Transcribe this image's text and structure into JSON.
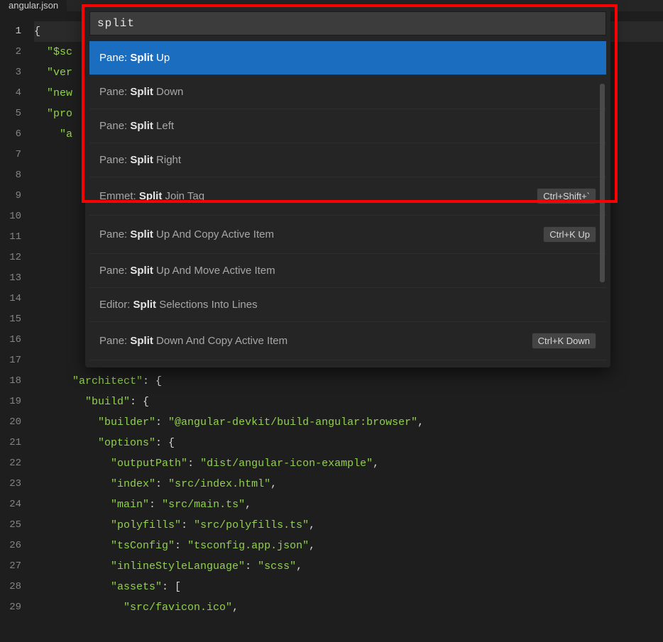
{
  "tab": {
    "title": "angular.json"
  },
  "gutter": [
    "1",
    "2",
    "3",
    "4",
    "5",
    "6",
    "7",
    "8",
    "9",
    "10",
    "11",
    "12",
    "13",
    "14",
    "15",
    "16",
    "17",
    "18",
    "19",
    "20",
    "21",
    "22",
    "23",
    "24",
    "25",
    "26",
    "27",
    "28",
    "29"
  ],
  "current_line": 1,
  "code_lines": [
    {
      "indent": 0,
      "tokens": [
        {
          "cls": "p",
          "t": "{"
        }
      ]
    },
    {
      "indent": 1,
      "tokens": [
        {
          "cls": "k",
          "t": "\"$sc"
        }
      ]
    },
    {
      "indent": 1,
      "tokens": [
        {
          "cls": "k",
          "t": "\"ver"
        }
      ]
    },
    {
      "indent": 1,
      "tokens": [
        {
          "cls": "k",
          "t": "\"new"
        }
      ]
    },
    {
      "indent": 1,
      "tokens": [
        {
          "cls": "k",
          "t": "\"pro"
        }
      ]
    },
    {
      "indent": 2,
      "tokens": [
        {
          "cls": "k",
          "t": "\"a"
        }
      ]
    },
    {
      "indent": 0,
      "tokens": []
    },
    {
      "indent": 0,
      "tokens": []
    },
    {
      "indent": 0,
      "tokens": []
    },
    {
      "indent": 0,
      "tokens": []
    },
    {
      "indent": 0,
      "tokens": []
    },
    {
      "indent": 0,
      "tokens": []
    },
    {
      "indent": 0,
      "tokens": []
    },
    {
      "indent": 0,
      "tokens": []
    },
    {
      "indent": 0,
      "tokens": []
    },
    {
      "indent": 0,
      "tokens": []
    },
    {
      "indent": 0,
      "tokens": []
    },
    {
      "indent": 3,
      "tokens": [
        {
          "cls": "k",
          "t": "\"architect\""
        },
        {
          "cls": "p",
          "t": ": {"
        }
      ]
    },
    {
      "indent": 4,
      "tokens": [
        {
          "cls": "k",
          "t": "\"build\""
        },
        {
          "cls": "p",
          "t": ": {"
        }
      ]
    },
    {
      "indent": 5,
      "tokens": [
        {
          "cls": "k",
          "t": "\"builder\""
        },
        {
          "cls": "p",
          "t": ": "
        },
        {
          "cls": "v",
          "t": "\"@angular-devkit/build-angular:browser\""
        },
        {
          "cls": "p",
          "t": ","
        }
      ]
    },
    {
      "indent": 5,
      "tokens": [
        {
          "cls": "k",
          "t": "\"options\""
        },
        {
          "cls": "p",
          "t": ": {"
        }
      ]
    },
    {
      "indent": 6,
      "tokens": [
        {
          "cls": "k",
          "t": "\"outputPath\""
        },
        {
          "cls": "p",
          "t": ": "
        },
        {
          "cls": "v",
          "t": "\"dist/angular-icon-example\""
        },
        {
          "cls": "p",
          "t": ","
        }
      ]
    },
    {
      "indent": 6,
      "tokens": [
        {
          "cls": "k",
          "t": "\"index\""
        },
        {
          "cls": "p",
          "t": ": "
        },
        {
          "cls": "v",
          "t": "\"src/index.html\""
        },
        {
          "cls": "p",
          "t": ","
        }
      ]
    },
    {
      "indent": 6,
      "tokens": [
        {
          "cls": "k",
          "t": "\"main\""
        },
        {
          "cls": "p",
          "t": ": "
        },
        {
          "cls": "v",
          "t": "\"src/main.ts\""
        },
        {
          "cls": "p",
          "t": ","
        }
      ]
    },
    {
      "indent": 6,
      "tokens": [
        {
          "cls": "k",
          "t": "\"polyfills\""
        },
        {
          "cls": "p",
          "t": ": "
        },
        {
          "cls": "v",
          "t": "\"src/polyfills.ts\""
        },
        {
          "cls": "p",
          "t": ","
        }
      ]
    },
    {
      "indent": 6,
      "tokens": [
        {
          "cls": "k",
          "t": "\"tsConfig\""
        },
        {
          "cls": "p",
          "t": ": "
        },
        {
          "cls": "v",
          "t": "\"tsconfig.app.json\""
        },
        {
          "cls": "p",
          "t": ","
        }
      ]
    },
    {
      "indent": 6,
      "tokens": [
        {
          "cls": "k",
          "t": "\"inlineStyleLanguage\""
        },
        {
          "cls": "p",
          "t": ": "
        },
        {
          "cls": "v",
          "t": "\"scss\""
        },
        {
          "cls": "p",
          "t": ","
        }
      ]
    },
    {
      "indent": 6,
      "tokens": [
        {
          "cls": "k",
          "t": "\"assets\""
        },
        {
          "cls": "p",
          "t": ": ["
        }
      ]
    },
    {
      "indent": 7,
      "tokens": [
        {
          "cls": "v",
          "t": "\"src/favicon.ico\""
        },
        {
          "cls": "p",
          "t": ","
        }
      ]
    }
  ],
  "palette": {
    "query": "split",
    "items": [
      {
        "prefix": "Pane: ",
        "match": "Split",
        "suffix": " Up",
        "kbd": "",
        "selected": true
      },
      {
        "prefix": "Pane: ",
        "match": "Split",
        "suffix": " Down",
        "kbd": "",
        "selected": false
      },
      {
        "prefix": "Pane: ",
        "match": "Split",
        "suffix": " Left",
        "kbd": "",
        "selected": false
      },
      {
        "prefix": "Pane: ",
        "match": "Split",
        "suffix": " Right",
        "kbd": "",
        "selected": false
      },
      {
        "prefix": "Emmet: ",
        "match": "Split",
        "suffix": " Join Tag",
        "kbd": "Ctrl+Shift+`",
        "selected": false
      },
      {
        "prefix": "Pane: ",
        "match": "Split",
        "suffix": " Up And Copy Active Item",
        "kbd": "Ctrl+K Up",
        "selected": false
      },
      {
        "prefix": "Pane: ",
        "match": "Split",
        "suffix": " Up And Move Active Item",
        "kbd": "",
        "selected": false
      },
      {
        "prefix": "Editor: ",
        "match": "Split",
        "suffix": " Selections Into Lines",
        "kbd": "",
        "selected": false
      },
      {
        "prefix": "Pane: ",
        "match": "Split",
        "suffix": " Down And Copy Active Item",
        "kbd": "Ctrl+K Down",
        "selected": false
      }
    ]
  }
}
